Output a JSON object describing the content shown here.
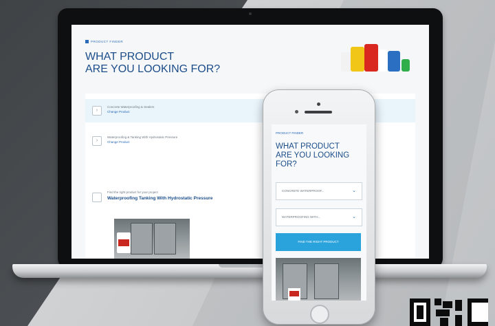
{
  "laptop": {
    "brand": "PRODUCT FINDER",
    "title_line1": "WHAT PRODUCT",
    "title_line2": "ARE YOU LOOKING FOR?",
    "rows": [
      {
        "text": "Concrete Waterproofing & Sealers",
        "link": "Change Product"
      },
      {
        "text": "Waterproofing & Tanking With Hydrostatic Pressure",
        "link": "Change Product"
      }
    ],
    "find_label": "Find the right product for your project",
    "find_title": "Waterproofing Tanking With Hydrostatic Pressure",
    "bottle_colors": [
      "#f2c617",
      "#d9281f",
      "#2b6fc2",
      "#2fae4a",
      "#ffffff"
    ]
  },
  "phone": {
    "brand": "PRODUCT FINDER",
    "title_line1": "WHAT PRODUCT",
    "title_line2": "ARE YOU LOOKING",
    "title_line3": "FOR?",
    "select1": "CONCRETE WATERPROOF...",
    "select2": "WATERPROOFING WITH...",
    "button": "FIND THE RIGHT PRODUCT"
  },
  "colors": {
    "brand_blue": "#1b4d8a",
    "accent_cyan": "#2aa2dc",
    "product_red": "#c8281f"
  }
}
